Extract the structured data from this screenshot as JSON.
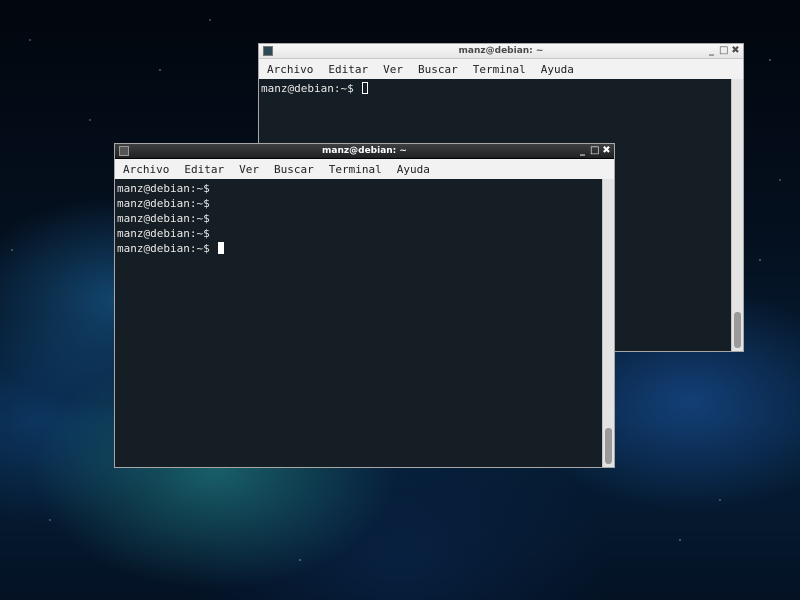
{
  "desktop": {
    "wallpaper": "nebula-space"
  },
  "windows": {
    "back": {
      "title": "manz@debian: ~",
      "menu": [
        "Archivo",
        "Editar",
        "Ver",
        "Buscar",
        "Terminal",
        "Ayuda"
      ],
      "lines": [
        "manz@debian:~$ "
      ],
      "cursor": "hollow"
    },
    "front": {
      "title": "manz@debian: ~",
      "menu": [
        "Archivo",
        "Editar",
        "Ver",
        "Buscar",
        "Terminal",
        "Ayuda"
      ],
      "lines": [
        "manz@debian:~$",
        "manz@debian:~$",
        "manz@debian:~$",
        "manz@debian:~$",
        "manz@debian:~$ "
      ],
      "cursor": "filled"
    }
  },
  "controls": {
    "minimize": "_",
    "maximize": "□",
    "close": "✖"
  },
  "colors": {
    "terminal_bg": "#020c12",
    "terminal_fg": "#e9e9e9",
    "active_titlebar": "#2a2b2d"
  }
}
